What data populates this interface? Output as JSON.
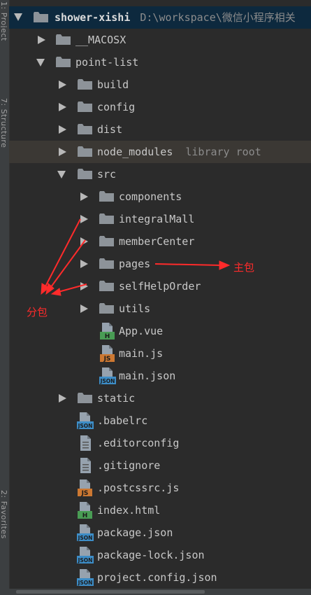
{
  "side_strip": {
    "top_label": "1: Project",
    "mid_label": "7: Structure",
    "bottom_label": "2: Favorites"
  },
  "tree": {
    "root": {
      "name": "shower-xishi",
      "path": "D:\\workspace\\微信小程序相关"
    },
    "macosx": "__MACOSX",
    "point_list": "point-list",
    "build": "build",
    "config": "config",
    "dist": "dist",
    "node_modules": "node_modules",
    "node_modules_hint": "library root",
    "src": "src",
    "components": "components",
    "integralMall": "integralMall",
    "memberCenter": "memberCenter",
    "pages": "pages",
    "selfHelpOrder": "selfHelpOrder",
    "utils": "utils",
    "app_vue": "App.vue",
    "main_js": "main.js",
    "main_json": "main.json",
    "static": "static",
    "babelrc": ".babelrc",
    "editorconfig": ".editorconfig",
    "gitignore": ".gitignore",
    "postcssrc": ".postcssrc.js",
    "index_html": "index.html",
    "package_json": "package.json",
    "package_lock": "package-lock.json",
    "project_config": "project.config.json"
  },
  "icon_badges": {
    "html": "H",
    "js": "JS",
    "json": "JSON"
  },
  "annotations": {
    "subpackage": "分包",
    "main_package": "主包"
  },
  "colors": {
    "background": "#2b2b2b",
    "selected_row": "#0d293e",
    "ignored_row": "#3b3834",
    "folder": "#8d9399",
    "annotation": "#ff2b2b"
  }
}
